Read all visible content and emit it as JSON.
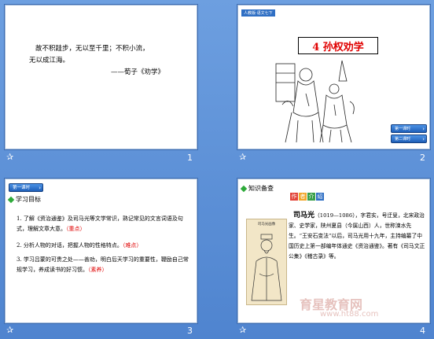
{
  "slides": [
    {
      "number": "1",
      "poem_line1": "故不积跬步，无以至千里；不积小流，",
      "poem_line2": "无以成江海。",
      "poem_source": "——荀子《劝学》"
    },
    {
      "number": "2",
      "tag": "人教版·语文七下",
      "title": "4 孙权劝学",
      "nav_buttons": [
        "第一课时",
        "第二课时"
      ]
    },
    {
      "number": "3",
      "lesson_button": "第一课时",
      "section_title": "学习目标",
      "objectives": [
        {
          "text": "1. 了解《资治通鉴》及司马光等文学常识，熟记常见的文言词语及句式，理解文章大意。",
          "tag": "（重点）"
        },
        {
          "text": "2. 分析人物的对话，把握人物的性格特点。",
          "tag": "（难点）"
        },
        {
          "text": "3. 学习吕蒙的可贵之处——善劝，明白后天学习的重要性，鞭励自己常规学习，养成读书的好习惯。",
          "tag": "（素养）"
        }
      ]
    },
    {
      "number": "4",
      "section_title": "知识备查",
      "header_tiles": [
        "作",
        "者",
        "介",
        "绍"
      ],
      "portrait_caption": "司马光画像",
      "bio_name": "司马光",
      "bio_text": "（1019—1086），字君实，号迂叟，北宋政治家、史学家，陕州夏县（今属山西）人，世称涑水先生。“王安石变法”以后，司马光用十九年，主持编纂了中国历史上第一部编年体通史《资治通鉴》。著有《司马文正公集》《稽古录》等。",
      "watermark_text": "育星教育网",
      "watermark_url": "www.ht88.com"
    }
  ],
  "colors": {
    "background": "#5a8fd6",
    "accent_red": "#e00000",
    "button_blue": "#1f5fb8",
    "gem_green": "#2eaa3a"
  },
  "icons": [
    "star-icon",
    "gem-icon",
    "chevron-right-icon"
  ]
}
